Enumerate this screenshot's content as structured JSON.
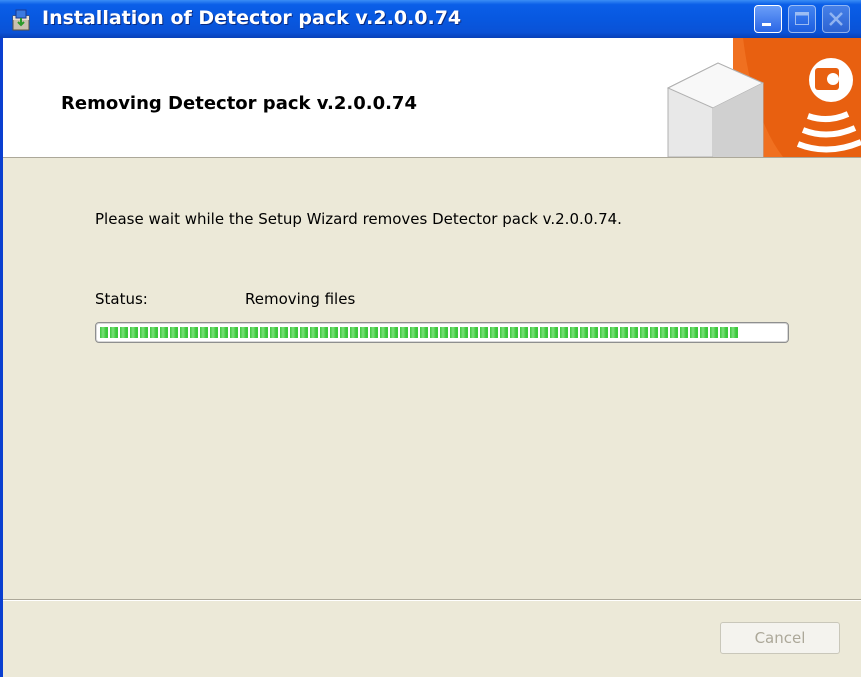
{
  "window": {
    "title": "Installation of Detector pack v.2.0.0.74",
    "icon": "installer-icon",
    "controls": [
      "minimize-icon",
      "maximize-icon",
      "close-icon"
    ]
  },
  "header": {
    "title": "Removing Detector pack v.2.0.0.74"
  },
  "body": {
    "description": "Please wait while the Setup Wizard removes Detector pack v.2.0.0.74.",
    "status_label": "Status:",
    "status_value": "Removing files",
    "progress_percent": 93
  },
  "footer": {
    "cancel_label": "Cancel",
    "cancel_enabled": false
  },
  "colors": {
    "titlebar": "#0A5EE8",
    "dialog_bg": "#ECE9D8",
    "progress_fill": "#3CC83C",
    "banner_accent": "#F07020"
  }
}
